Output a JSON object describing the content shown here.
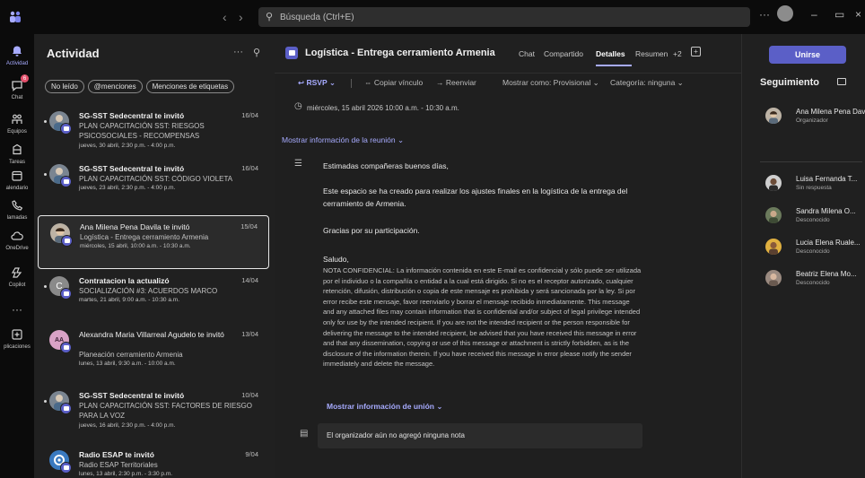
{
  "titlebar": {
    "search_placeholder": "Búsqueda (Ctrl+E)",
    "more_label": "···"
  },
  "rail": {
    "items": [
      {
        "label": "Actividad"
      },
      {
        "label": "Chat",
        "badge": "6"
      },
      {
        "label": "Equipos"
      },
      {
        "label": "Tareas"
      },
      {
        "label": "alendario"
      },
      {
        "label": "lamadas"
      },
      {
        "label": "OneDrive"
      },
      {
        "label": "Copilot"
      },
      {
        "label": "···"
      },
      {
        "label": "plicaciones"
      }
    ]
  },
  "activity": {
    "title": "Actividad",
    "more": "···",
    "filters": [
      "No leído",
      "@menciones",
      "Menciones de etiquetas"
    ],
    "items": [
      {
        "title": "SG-SST Sedecentral te invitó",
        "date": "16/04",
        "subject": "PLAN CAPACITACIÓN SST: RIESGOS PSICOSOCIALES - RECOMPENSAS",
        "time": "jueves, 30 abril, 2:30 p.m. - 4:00 p.m."
      },
      {
        "title": "SG-SST Sedecentral te invitó",
        "date": "16/04",
        "subject": "PLAN CAPACITACIÓN SST: CÓDIGO VIOLETA",
        "time": "jueves, 23 abril, 2:30 p.m. - 4:00 p.m."
      },
      {
        "title": "Ana Milena Pena Davila te invitó",
        "date": "15/04",
        "subject": "Logística - Entrega cerramiento Armenia",
        "time": "miércoles, 15 abril, 10:00 a.m. - 10:30 a.m."
      },
      {
        "title": "Contratacion la actualizó",
        "date": "14/04",
        "subject": "SOCIALIZACIÓN #3: ACUERDOS MARCO",
        "time": "martes, 21 abril, 9:00 a.m. - 10:30 a.m."
      },
      {
        "title": "Alexandra Maria Villarreal Agudelo te invitó",
        "date": "13/04",
        "subject": "Planeación cerramiento Armenia",
        "time": "lunes, 13 abril, 9:30 a.m. - 10:00 a.m.",
        "initials": "AA"
      },
      {
        "title": "SG-SST Sedecentral te invitó",
        "date": "10/04",
        "subject": "PLAN CAPACITACIÓN SST: FACTORES DE RIESGO PARA LA VOZ",
        "time": "jueves, 16 abril, 2:30 p.m. - 4:00 p.m."
      },
      {
        "title": "Radio ESAP te invitó",
        "date": "9/04",
        "subject": "Radio ESAP Territoriales",
        "time": "lunes, 13 abril, 2:30 p.m. - 3:30 p.m."
      }
    ]
  },
  "meeting": {
    "title": "Logística - Entrega cerramiento Armenia",
    "tabs": [
      "Chat",
      "Compartido",
      "Detalles",
      "Resumen",
      "+2"
    ],
    "toolbar": {
      "rsvp": "RSVP",
      "copy_link": "Copiar vínculo",
      "forward": "Reenviar",
      "show_as": "Mostrar como: Provisional",
      "category": "Categoría: ninguna"
    },
    "datetime": "miércoles, 15 abril 2026 10:00 a.m. - 10:30 a.m.",
    "show_meeting_info": "Mostrar información de la reunión",
    "greeting": "Estimadas compañeras buenos días,",
    "paragraph": "Este espacio se ha creado para realizar los ajustes finales en la logística de la entrega del cerramiento de Armenia.",
    "thanks": "Gracias por su participación.",
    "salute": "Saludo,",
    "disclaimer": "NOTA CONFIDENCIAL: La información contenida en este E-mail es confidencial y sólo puede ser utilizada por el individuo o la compañía o entidad a la cual está dirigido. Si no es el receptor autorizado, cualquier retención, difusión, distribución o copia de este mensaje es prohibida y será sancionada por la ley. Si por error recibe este mensaje, favor reenviarlo y borrar el mensaje recibido inmediatamente. This message and any attached files may contain information that is confidential and/or subject of legal privilege intended only for use by the intended recipient. If you are not the intended recipient or the person responsible for delivering the message to the intended recipient, be advised that you have received this message in error and that any dissemination, copying or use of this message or attachment is strictly forbidden, as is the disclosure of the information therein. If you have received this message in error please notify the sender immediately and delete the message.",
    "show_join_info": "Mostrar información de unión",
    "note_placeholder": "El organizador aún no agregó ninguna nota"
  },
  "tracking": {
    "join_button": "Unirse",
    "title": "Seguimiento",
    "organizer": {
      "name": "Ana Milena Pena Dav",
      "role": "Organizador"
    },
    "attendees": [
      {
        "name": "Luisa Fernanda T...",
        "status": "Sin respuesta"
      },
      {
        "name": "Sandra Milena O...",
        "status": "Desconocido"
      },
      {
        "name": "Lucia Elena Ruale...",
        "status": "Desconocido"
      },
      {
        "name": "Beatriz Elena Mo...",
        "status": "Desconocido"
      }
    ]
  },
  "colors": {
    "accent": "#5b5fc7",
    "link": "#a7abff",
    "badge": "#e3506b"
  }
}
